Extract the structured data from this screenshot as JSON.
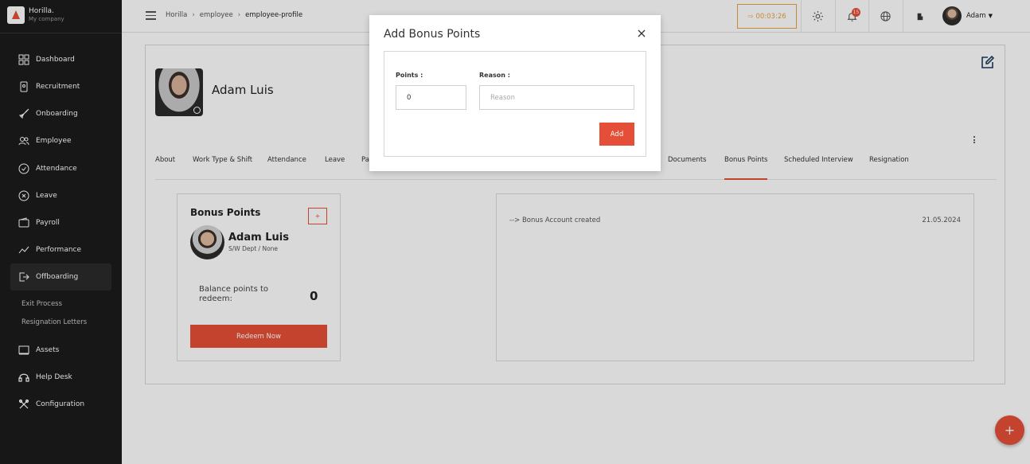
{
  "brand": {
    "name": "Horilla.",
    "company": "My company"
  },
  "sidebar": {
    "items": [
      {
        "label": "Dashboard",
        "icon": "dashboard-icon"
      },
      {
        "label": "Recruitment",
        "icon": "recruitment-icon"
      },
      {
        "label": "Onboarding",
        "icon": "rocket-icon"
      },
      {
        "label": "Employee",
        "icon": "people-icon"
      },
      {
        "label": "Attendance",
        "icon": "check-circle-icon"
      },
      {
        "label": "Leave",
        "icon": "leave-icon"
      },
      {
        "label": "Payroll",
        "icon": "wallet-icon"
      },
      {
        "label": "Performance",
        "icon": "chart-line-icon"
      },
      {
        "label": "Offboarding",
        "icon": "exit-icon"
      },
      {
        "label": "Assets",
        "icon": "laptop-icon"
      },
      {
        "label": "Help Desk",
        "icon": "headset-icon"
      },
      {
        "label": "Configuration",
        "icon": "tools-icon"
      }
    ],
    "sub_items": [
      "Exit Process",
      "Resignation Letters"
    ]
  },
  "header": {
    "breadcrumbs": [
      "Horilla",
      "employee",
      "employee-profile"
    ],
    "timer": "00:03:26",
    "notification_count": "15",
    "user_name": "Adam"
  },
  "profile": {
    "name": "Adam Luis",
    "tabs": [
      "About",
      "Work Type & Shift",
      "Attendance",
      "Leave",
      "Pa",
      "Documents",
      "Bonus Points",
      "Scheduled Interview",
      "Resignation"
    ],
    "active_tab": "Bonus Points"
  },
  "bonus_card": {
    "title": "Bonus Points",
    "plus_label": "+",
    "employee_name": "Adam Luis",
    "department": "S/W Dept / None",
    "balance_label": "Balance points to redeem:",
    "balance_value": "0",
    "redeem_label": "Redeem Now"
  },
  "history": {
    "entry_text": "--> Bonus Account created",
    "entry_date": "21.05.2024"
  },
  "modal": {
    "title": "Add Bonus Points",
    "points_label": "Points :",
    "points_value": "0",
    "reason_label": "Reason :",
    "reason_placeholder": "Reason",
    "add_label": "Add"
  },
  "fab_label": "+",
  "colors": {
    "accent": "#e54f38",
    "sidebar_bg": "#1c1c1c",
    "timer": "#e8a33d"
  }
}
